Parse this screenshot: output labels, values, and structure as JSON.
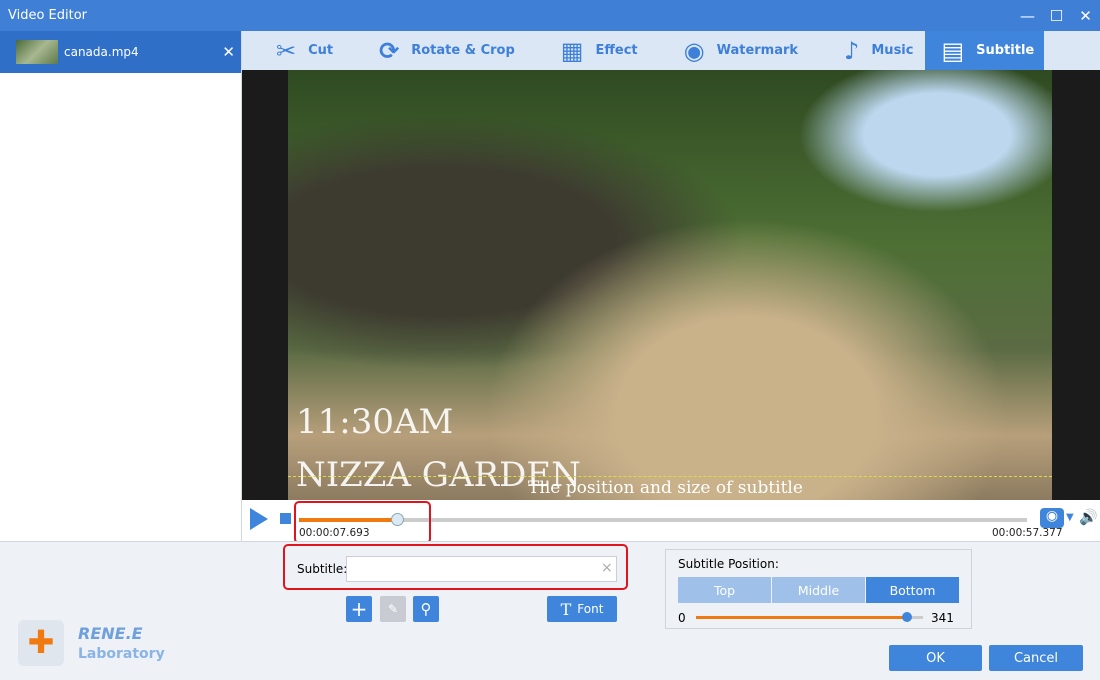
{
  "window": {
    "title": "Video Editor",
    "controls": [
      "—",
      "☐",
      "✕"
    ]
  },
  "file": {
    "name": "canada.mp4",
    "close": "✕"
  },
  "tabs": [
    {
      "label": "Cut",
      "icon": "scissors-icon",
      "glyph": "✂"
    },
    {
      "label": "Rotate & Crop",
      "icon": "crop-icon",
      "glyph": "⟳"
    },
    {
      "label": "Effect",
      "icon": "effect-icon",
      "glyph": "▦"
    },
    {
      "label": "Watermark",
      "icon": "watermark-icon",
      "glyph": "◉"
    },
    {
      "label": "Music",
      "icon": "music-icon",
      "glyph": "♪"
    },
    {
      "label": "Subtitle",
      "icon": "subtitle-icon",
      "glyph": "▤",
      "active": true
    }
  ],
  "video": {
    "burned_time": "11:30AM",
    "burned_place": "NIZZA GARDEN",
    "subtitle_preview": "The position and size of subtitle"
  },
  "player": {
    "current": "00:00:07.693",
    "total": "00:00:57.377",
    "progress": 0.134
  },
  "subtitle": {
    "label": "Subtitle:",
    "value": "",
    "clear": "×"
  },
  "font_button": "Font",
  "position": {
    "title": "Subtitle Position:",
    "options": [
      "Top",
      "Middle",
      "Bottom"
    ],
    "selected": "Bottom",
    "min": "0",
    "value": "341",
    "fraction": 0.93
  },
  "logo": {
    "brand": "RENE.E",
    "sub": "Laboratory"
  },
  "ok": "OK",
  "cancel": "Cancel",
  "colors": {
    "accent": "#3f85dc",
    "progress": "#f07a10",
    "highlight": "#e0141c"
  }
}
